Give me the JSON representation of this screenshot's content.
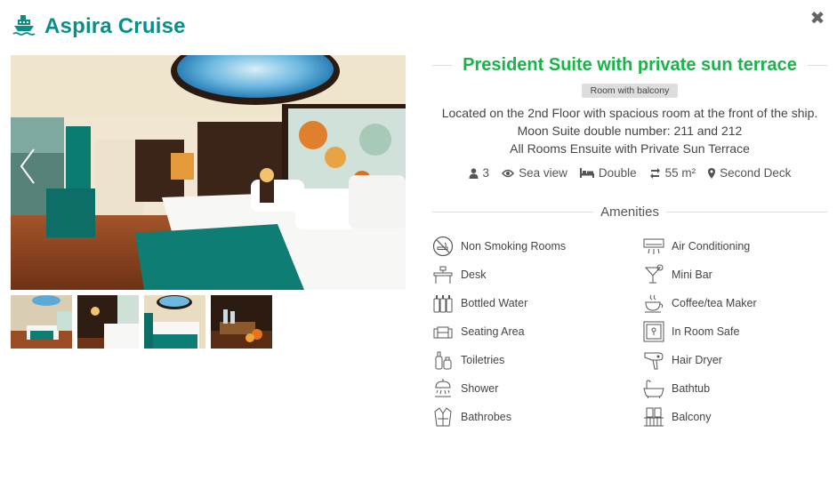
{
  "header": {
    "title": "Aspira Cruise",
    "logo_icon": "cruise-ship-icon",
    "brand_color": "#0b8e8a"
  },
  "close_icon": "close-icon",
  "room": {
    "title": "President Suite with private sun terrace",
    "title_color": "#19b349",
    "badge": "Room with balcony",
    "description": [
      "Located on the 2nd Floor with spacious room at the front of the ship.",
      "Moon Suite double number: 211 and 212",
      "All Rooms Ensuite with Private Sun Terrace"
    ],
    "facts": {
      "guests": "3",
      "view": "Sea view",
      "bed": "Double",
      "size": "55 m²",
      "deck": "Second Deck"
    }
  },
  "amenities": {
    "heading": "Amenities",
    "items": [
      {
        "label": "Non Smoking Rooms",
        "icon": "no-smoking-icon"
      },
      {
        "label": "Air Conditioning",
        "icon": "air-conditioner-icon"
      },
      {
        "label": "Desk",
        "icon": "desk-icon"
      },
      {
        "label": "Mini Bar",
        "icon": "cocktail-icon"
      },
      {
        "label": "Bottled Water",
        "icon": "water-bottle-icon"
      },
      {
        "label": "Coffee/tea Maker",
        "icon": "coffee-cup-icon"
      },
      {
        "label": "Seating Area",
        "icon": "sofa-icon"
      },
      {
        "label": "In Room Safe",
        "icon": "safe-icon"
      },
      {
        "label": "Toiletries",
        "icon": "toiletries-icon"
      },
      {
        "label": "Hair Dryer",
        "icon": "hair-dryer-icon"
      },
      {
        "label": "Shower",
        "icon": "shower-icon"
      },
      {
        "label": "Bathtub",
        "icon": "bathtub-icon"
      },
      {
        "label": "Bathrobes",
        "icon": "bathrobe-icon"
      },
      {
        "label": "Balcony",
        "icon": "balcony-icon"
      }
    ]
  }
}
